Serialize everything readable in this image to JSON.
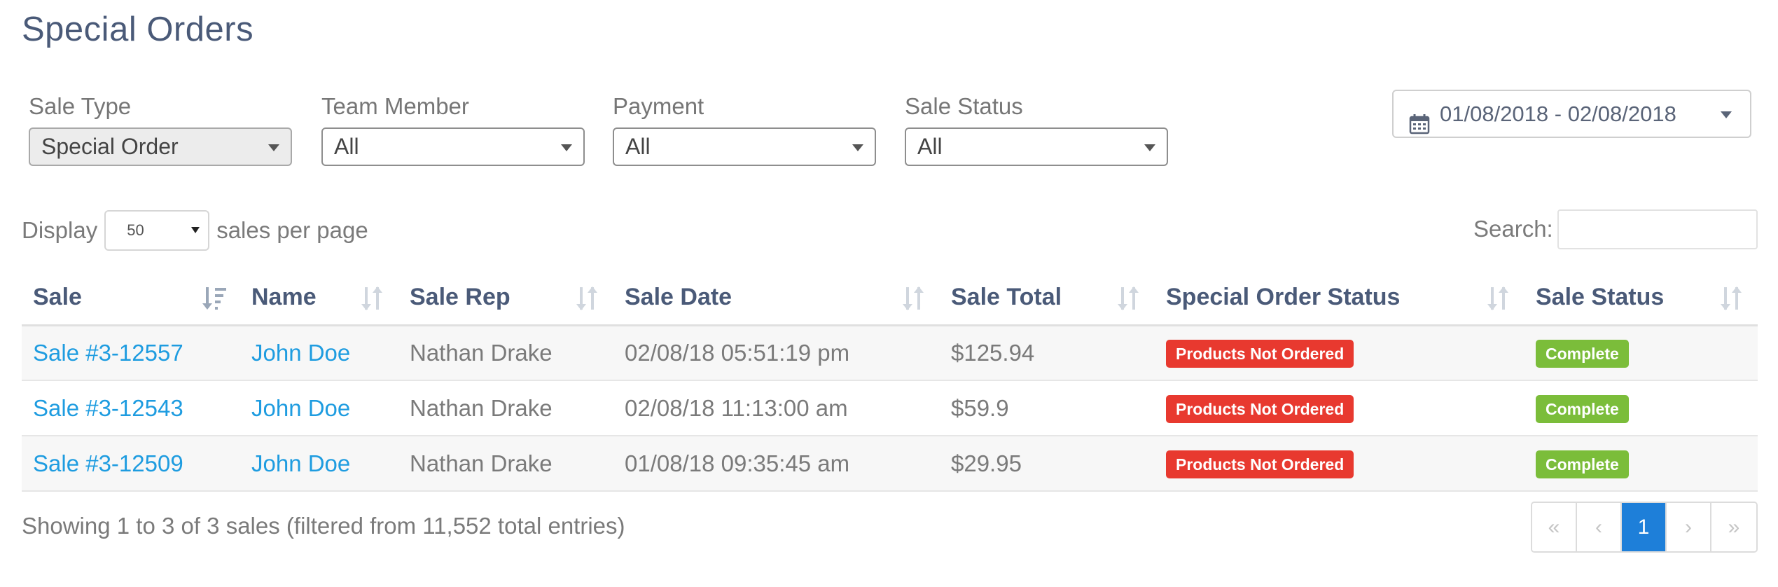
{
  "page": {
    "title": "Special Orders"
  },
  "filters": [
    {
      "label": "Sale Type",
      "value": "Special Order"
    },
    {
      "label": "Team Member",
      "value": "All"
    },
    {
      "label": "Payment",
      "value": "All"
    },
    {
      "label": "Sale Status",
      "value": "All"
    }
  ],
  "date_range": {
    "value": "01/08/2018 - 02/08/2018",
    "icon": "calendar-icon"
  },
  "display": {
    "prefix": "Display",
    "page_size": "50",
    "suffix": "sales per page"
  },
  "search": {
    "label": "Search:",
    "value": ""
  },
  "table": {
    "columns": [
      "Sale",
      "Name",
      "Sale Rep",
      "Sale Date",
      "Sale Total",
      "Special Order Status",
      "Sale Status"
    ],
    "rows": [
      {
        "sale": "Sale #3-12557",
        "name": "John Doe",
        "rep": "Nathan Drake",
        "date": "02/08/18 05:51:19 pm",
        "total": "$125.94",
        "so_status": "Products Not Ordered",
        "sale_status": "Complete"
      },
      {
        "sale": "Sale #3-12543",
        "name": "John Doe",
        "rep": "Nathan Drake",
        "date": "02/08/18 11:13:00 am",
        "total": "$59.9",
        "so_status": "Products Not Ordered",
        "sale_status": "Complete"
      },
      {
        "sale": "Sale #3-12509",
        "name": "John Doe",
        "rep": "Nathan Drake",
        "date": "01/08/18 09:35:45 am",
        "total": "$29.95",
        "so_status": "Products Not Ordered",
        "sale_status": "Complete"
      }
    ]
  },
  "summary": "Showing 1 to 3 of 3 sales (filtered from 11,552 total entries)",
  "pagination": {
    "first": "«",
    "prev": "‹",
    "current": "1",
    "next": "›",
    "last": "»"
  },
  "colors": {
    "title": "#4a5a78",
    "link": "#1e9ce0",
    "badge_red": "#e8392f",
    "badge_green": "#7bbd3a",
    "page_active": "#1e7fd9"
  }
}
